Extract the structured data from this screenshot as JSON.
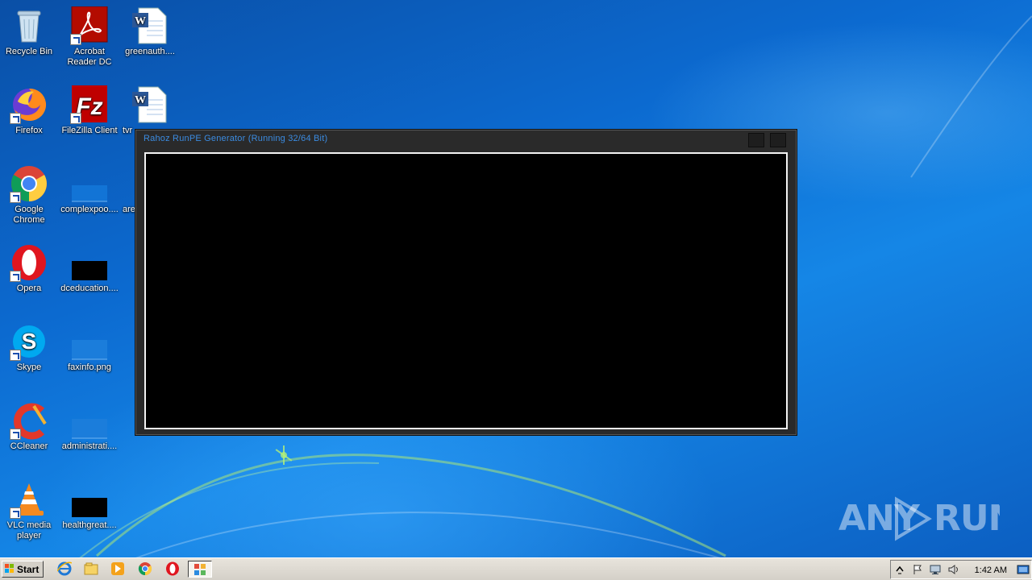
{
  "desktop": {
    "icons": [
      {
        "label": "Recycle Bin",
        "icon": "recycle-bin-icon"
      },
      {
        "label": "Acrobat Reader DC",
        "icon": "acrobat-icon"
      },
      {
        "label": "greenauth....",
        "icon": "word-doc-icon"
      },
      {
        "label": "Firefox",
        "icon": "firefox-icon"
      },
      {
        "label": "FileZilla Client",
        "icon": "filezilla-icon"
      },
      {
        "label": "tvr",
        "icon": "word-doc-icon"
      },
      {
        "label": "Google Chrome",
        "icon": "chrome-icon"
      },
      {
        "label": "complexpoo....",
        "icon": "blank-file-icon"
      },
      {
        "label": "are",
        "icon": "blank-file-icon"
      },
      {
        "label": "Opera",
        "icon": "opera-icon"
      },
      {
        "label": "dceducation....",
        "icon": "black-image-icon"
      },
      {
        "label": "Skype",
        "icon": "skype-icon"
      },
      {
        "label": "faxinfo.png",
        "icon": "blank-image-icon"
      },
      {
        "label": "CCleaner",
        "icon": "ccleaner-icon"
      },
      {
        "label": "administrati....",
        "icon": "blank-file-icon"
      },
      {
        "label": "VLC media player",
        "icon": "vlc-icon"
      },
      {
        "label": "healthgreat....",
        "icon": "black-image-icon"
      }
    ]
  },
  "window": {
    "title": "Rahoz RunPE Generator (Running 32/64 Bit)"
  },
  "watermark": "ANY RUN",
  "taskbar": {
    "start_label": "Start",
    "pinned": [
      "ie-icon",
      "explorer-icon",
      "media-player-icon",
      "chrome-icon",
      "opera-icon"
    ],
    "active_app_icon": "runpe-app-icon"
  },
  "tray": {
    "time": "1:42 AM",
    "icons": [
      "show-hidden-icon",
      "action-center-flag-icon",
      "network-icon",
      "volume-icon"
    ]
  }
}
